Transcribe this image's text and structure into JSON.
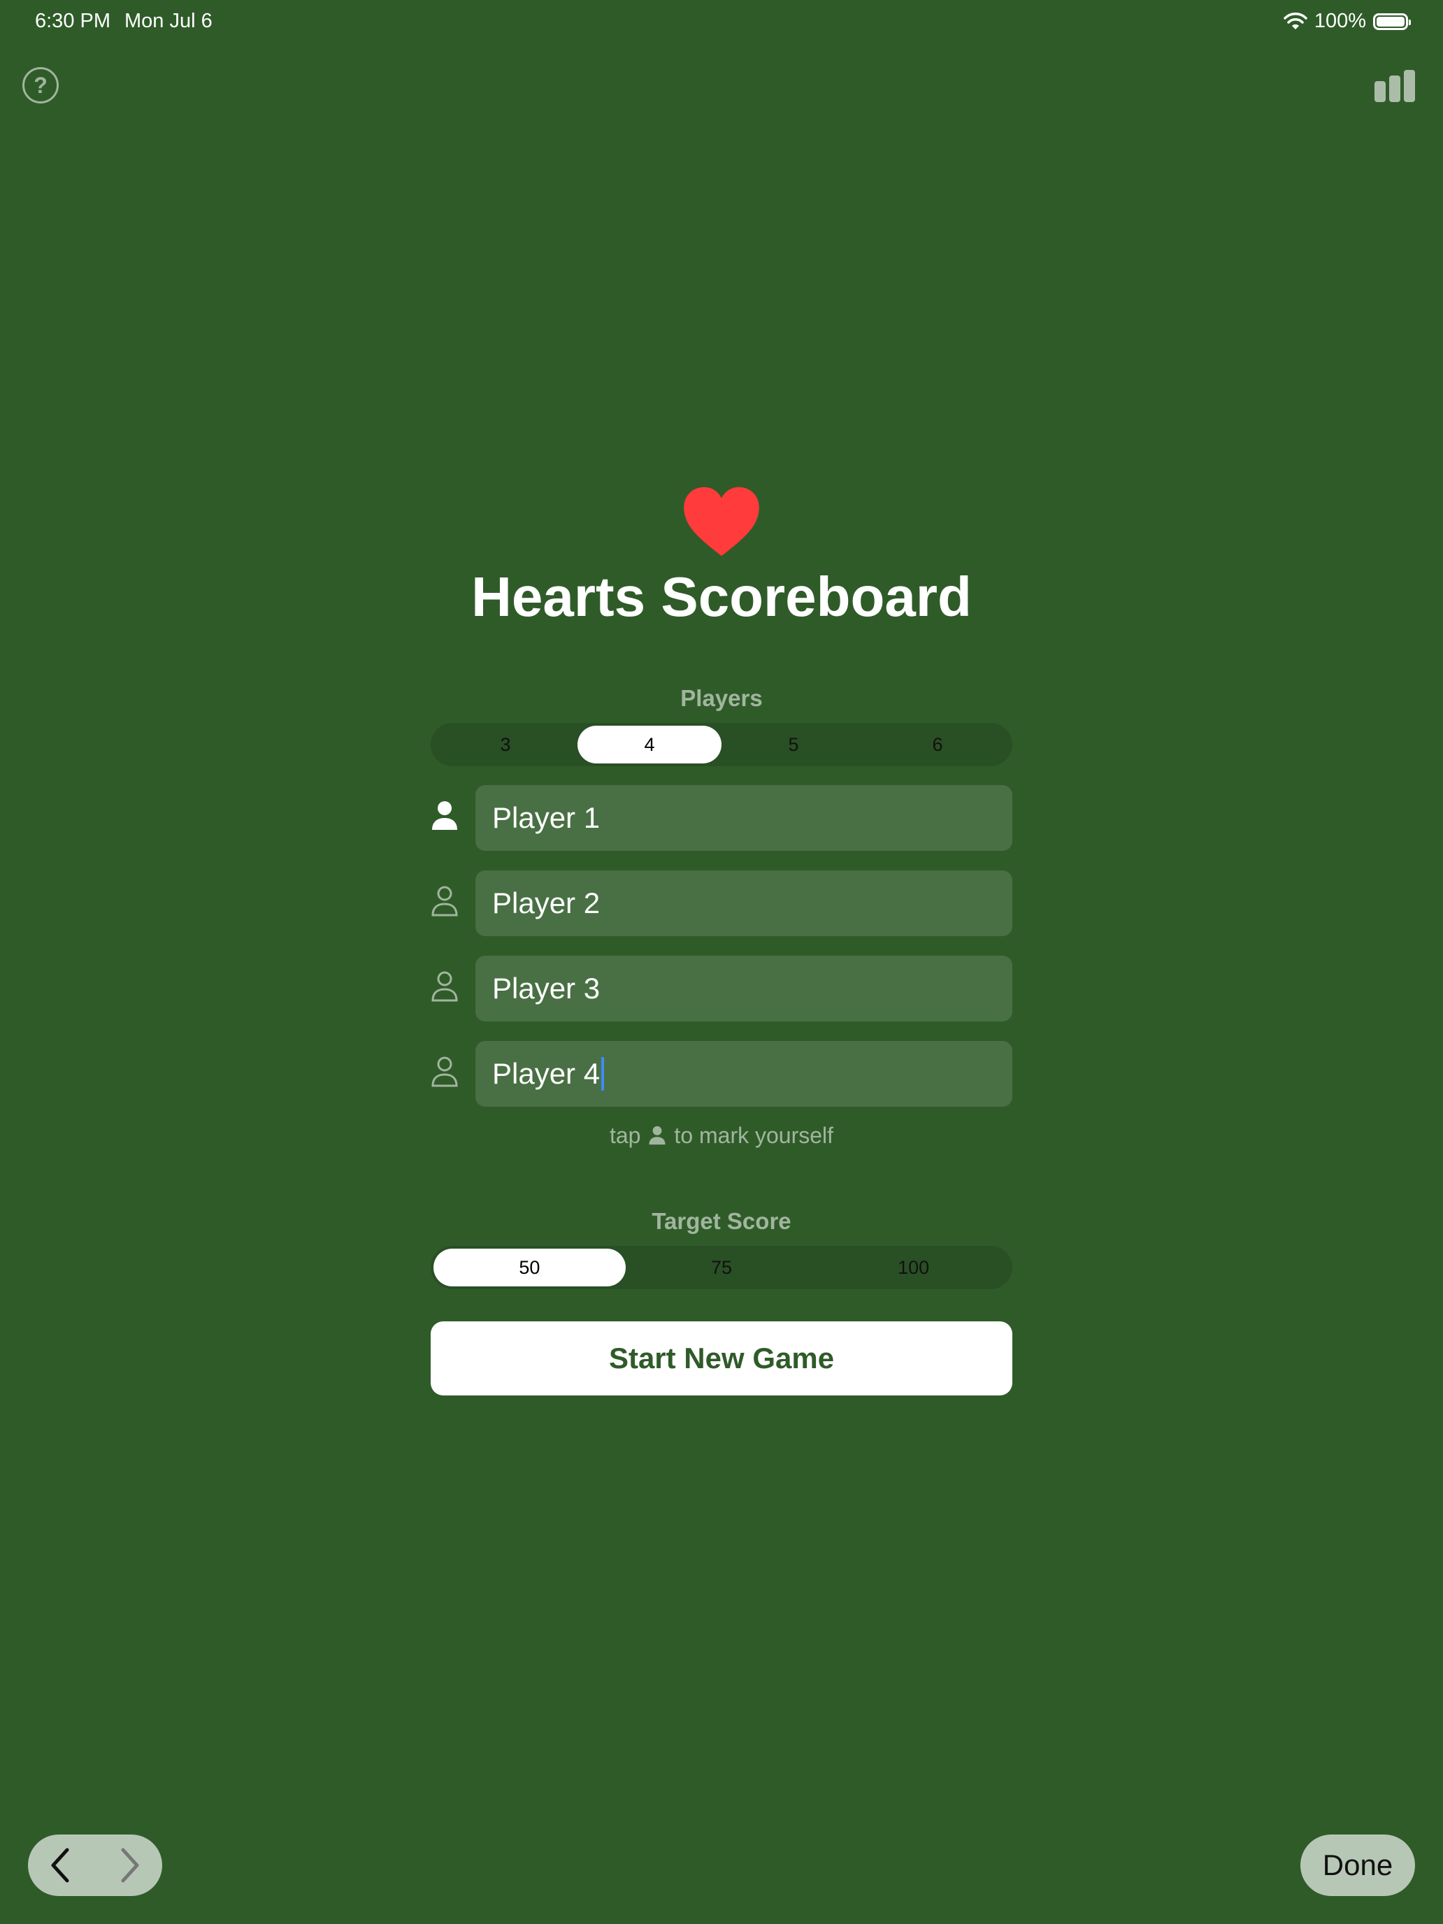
{
  "status_bar": {
    "time": "6:30 PM",
    "date": "Mon Jul 6",
    "battery": "100%",
    "battery_level": 1.0
  },
  "toolbar": {
    "help_icon": "question-circle-icon",
    "stats_icon": "bar-chart-icon"
  },
  "app": {
    "title": "Hearts Scoreboard",
    "logo_icon": "heart-icon",
    "accent_color": "#ff3b3b",
    "background_color": "#2f5b29"
  },
  "players_section": {
    "label": "Players",
    "options": [
      "3",
      "4",
      "5",
      "6"
    ],
    "selected": "4",
    "players": [
      {
        "name": "Player 1",
        "is_me": true
      },
      {
        "name": "Player 2",
        "is_me": false
      },
      {
        "name": "Player 3",
        "is_me": false
      },
      {
        "name": "Player 4",
        "is_me": false
      }
    ],
    "hint_before": "tap",
    "hint_after": "to mark yourself"
  },
  "target_section": {
    "label": "Target Score",
    "options": [
      "50",
      "75",
      "100"
    ],
    "selected": "50"
  },
  "start_button": {
    "label": "Start New Game"
  },
  "bottom": {
    "back_icon": "chevron-left-icon",
    "forward_icon": "chevron-right-icon",
    "done_label": "Done"
  }
}
